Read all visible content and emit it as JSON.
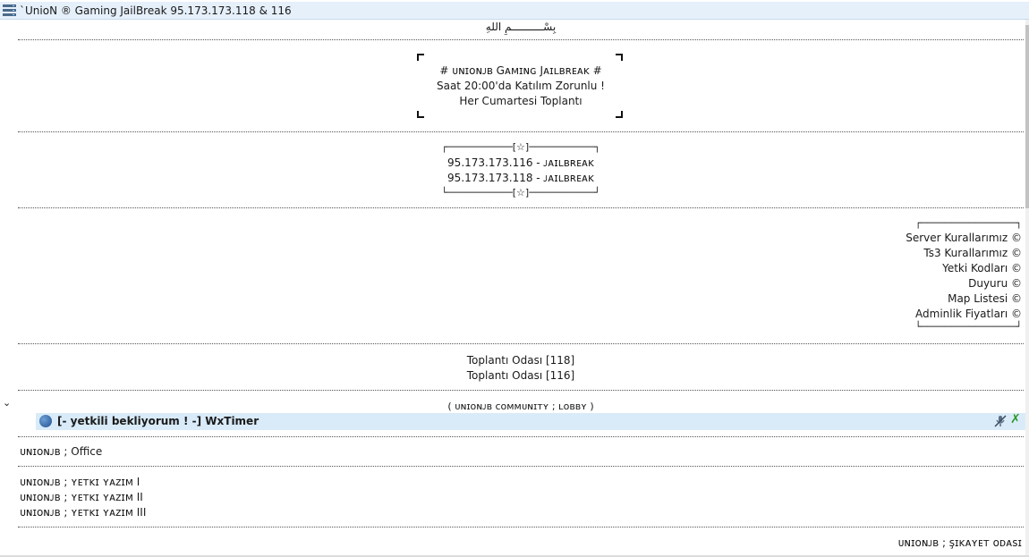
{
  "server": {
    "title": "`UnioN ® Gaming JailBreak 95.173.173.118 & 116"
  },
  "channels": {
    "bismillah": "بِسْــــــــــمِ اللهِ",
    "announce_box": [
      "# ᴜɴɪᴏɴᴊʙ Gᴀᴍɪɴɢ Jᴀɪʟʙʀᴇᴀᴋ #",
      "Saat 20:00'da Katılım Zorunlu !",
      "Her Cumartesi Toplantı"
    ],
    "star_top": "┌───────────[☆]───────────┐",
    "star_bottom": "└───────────[☆]───────────┘",
    "ips": [
      "95.173.173.116 - ᴊᴀɪʟʙʀᴇᴀᴋ",
      "95.173.173.118 - ᴊᴀɪʟʙʀᴇᴀᴋ"
    ],
    "rules_top": "┌────────────────┐",
    "rules_bottom": "└────────────────┘",
    "rules": [
      "Server Kurallarımız ©",
      "Ts3 Kurallarımız ©",
      "Yetki Kodları ©",
      "Duyuru ©",
      "Map Listesi ©",
      "Adminlik Fiyatları ©"
    ],
    "meeting": [
      "Toplantı Odası [118]",
      "Toplantı Odası [116]"
    ],
    "lobby": "( ᴜɴɪᴏɴᴊʙ ᴄᴏᴍᴍᴜɴɪᴛʏ ; ʟᴏʙʙʏ )",
    "lobby_user": "[- yetkili bekliyorum ! -] WxTimer",
    "office": "ᴜɴɪᴏɴᴊʙ ; Office",
    "yetki": [
      "ᴜɴɪᴏɴᴊʙ ; ʏᴇᴛᴋɪ ʏᴀᴢɪᴍ I",
      "ᴜɴɪᴏɴᴊʙ ; ʏᴇᴛᴋɪ ʏᴀᴢɪᴍ II",
      "ᴜɴɪᴏɴᴊʙ ; ʏᴇᴛᴋɪ ʏᴀᴢɪᴍ III"
    ],
    "sikayet": "ᴜɴɪᴏɴᴊʙ ; şɪᴋᴀʏᴇᴛ ᴏᴅᴀsɪ"
  },
  "icons": {
    "server": "server-icon",
    "expand": "chevron-down-icon",
    "client_status": "client-status-icon",
    "mute": "microphone-muted-icon",
    "away": "close-x-icon"
  },
  "colors": {
    "title_bg": "#e6f0fb",
    "row_highlight": "#d9ebf9",
    "x_green": "#2a9a2a"
  }
}
